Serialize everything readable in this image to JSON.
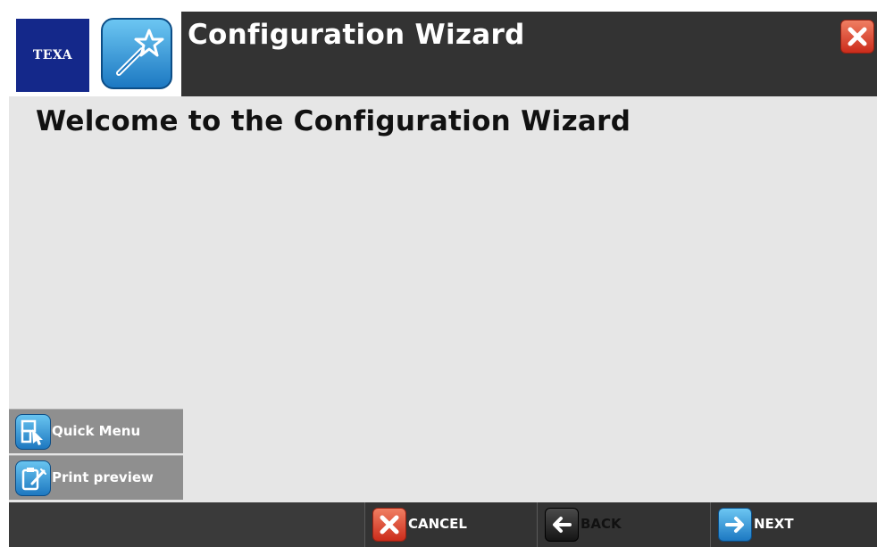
{
  "header": {
    "logo_text": "TEXA",
    "title": "Configuration Wizard",
    "close_icon": "close-icon"
  },
  "content": {
    "heading": "Welcome to the Configuration Wizard"
  },
  "side_menu": {
    "quick_menu_label": "Quick Menu",
    "print_preview_label": "Print preview"
  },
  "footer": {
    "cancel_label": "CANCEL",
    "back_label": "BACK",
    "next_label": "NEXT"
  },
  "colors": {
    "header_bg": "#333333",
    "content_bg": "#e6e6e6",
    "logo_blue": "#14288a",
    "accent_blue": "#1c78c2",
    "close_red": "#cc2c1b"
  }
}
